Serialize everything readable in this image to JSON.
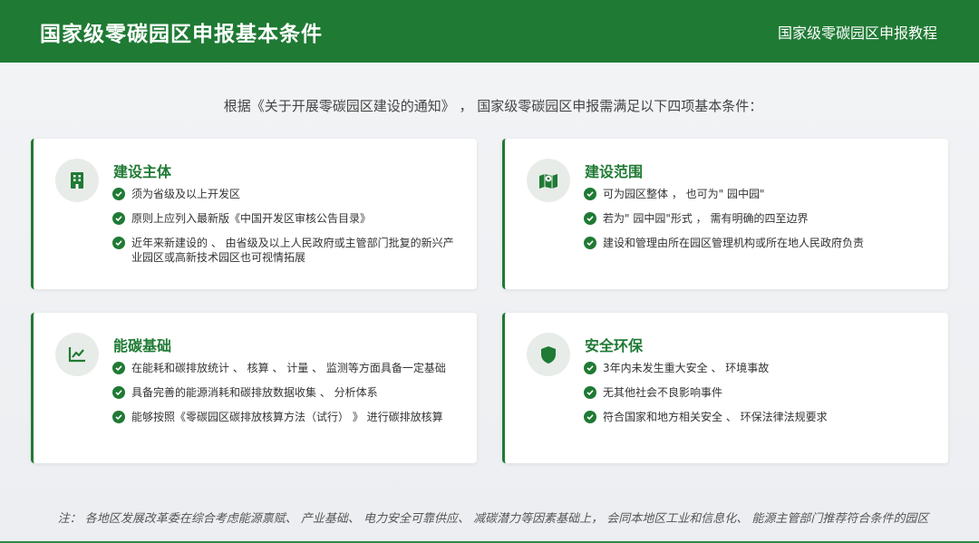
{
  "header": {
    "title": "国家级零碳园区申报基本条件",
    "subtitle": "国家级零碳园区申报教程"
  },
  "intro": "根据《关于开展零碳园区建设的通知》 ， 国家级零碳园区申报需满足以下四项基本条件：",
  "colors": {
    "primary": "#1f7a34",
    "icon_bg": "#e8ece9"
  },
  "cards": [
    {
      "title": "建设主体",
      "icon": "building-icon",
      "items": [
        "须为省级及以上开发区",
        "原则上应列入最新版《中国开发区审核公告目录》",
        "近年来新建设的 、 由省级及以上人民政府或主管部门批复的新兴产业园区或高新技术园区也可视情拓展"
      ]
    },
    {
      "title": "建设范围",
      "icon": "map-icon",
      "items": [
        "可为园区整体 ， 也可为\" 园中园\"",
        "若为\" 园中园\"形式 ， 需有明确的四至边界",
        "建设和管理由所在园区管理机构或所在地人民政府负责"
      ]
    },
    {
      "title": "能碳基础",
      "icon": "chart-line-icon",
      "items": [
        "在能耗和碳排放统计 、 核算 、 计量 、 监测等方面具备一定基础",
        "具备完善的能源消耗和碳排放数据收集 、 分析体系",
        "能够按照《零碳园区碳排放核算方法（试行） 》 进行碳排放核算"
      ]
    },
    {
      "title": "安全环保",
      "icon": "shield-icon",
      "items": [
        "3年内未发生重大安全 、 环境事故",
        "无其他社会不良影响事件",
        "符合国家和地方相关安全 、 环保法律法规要求"
      ]
    }
  ],
  "note": "注： 各地区发展改革委在综合考虑能源禀赋、 产业基础、 电力安全可靠供应、 减碳潜力等因素基础上， 会同本地区工业和信息化、 能源主管部门推荐符合条件的园区"
}
